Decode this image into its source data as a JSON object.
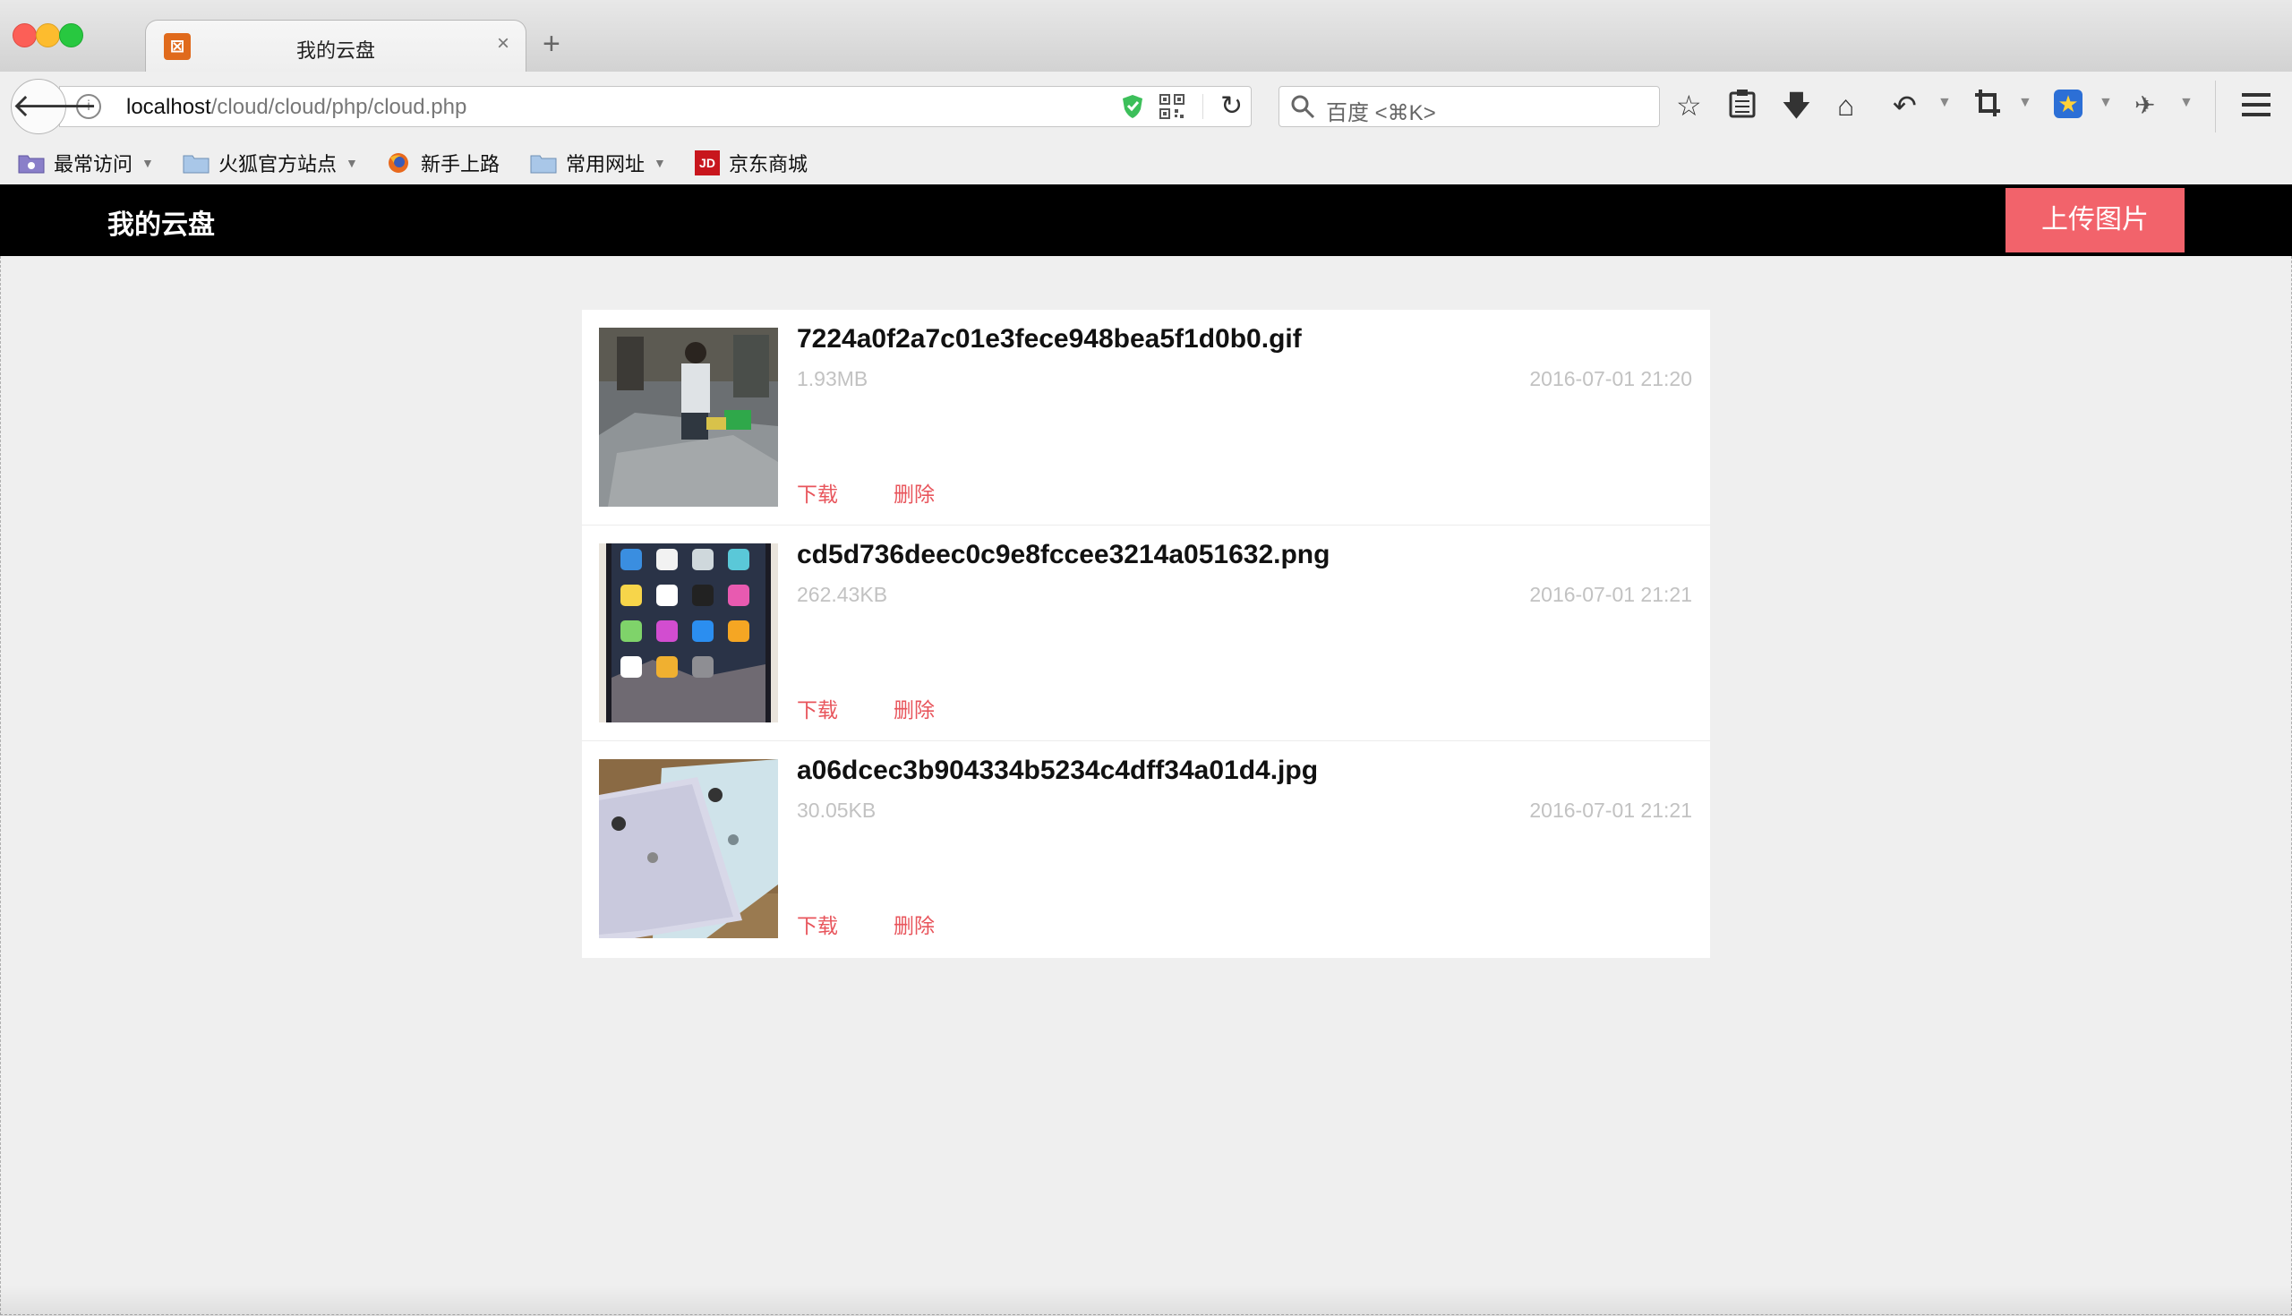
{
  "browser": {
    "tab_title": "我的云盘",
    "new_tab": "+",
    "tab_close": "×",
    "url_host": "localhost",
    "url_path": "/cloud/cloud/php/cloud.php",
    "search_placeholder": "百度 <⌘K>",
    "favicon_label": "⊠",
    "bookmarks": [
      {
        "label": "最常访问",
        "icon": "smart-folder-icon",
        "dropdown": true
      },
      {
        "label": "火狐官方站点",
        "icon": "folder-icon",
        "dropdown": true
      },
      {
        "label": "新手上路",
        "icon": "firefox-icon",
        "dropdown": false
      },
      {
        "label": "常用网址",
        "icon": "folder-icon",
        "dropdown": true
      },
      {
        "label": "京东商城",
        "icon": "jd-icon",
        "dropdown": false
      }
    ],
    "jd_icon_text": "JD"
  },
  "app": {
    "title": "我的云盘",
    "upload_label": "上传图片"
  },
  "files": [
    {
      "name": "7224a0f2a7c01e3fece948bea5f1d0b0.gif",
      "size": "1.93MB",
      "date": "2016-07-01 21:20",
      "download": "下载",
      "delete": "删除"
    },
    {
      "name": "cd5d736deec0c9e8fccee3214a051632.png",
      "size": "262.43KB",
      "date": "2016-07-01 21:21",
      "download": "下载",
      "delete": "删除"
    },
    {
      "name": "a06dcec3b904334b5234c4dff34a01d4.jpg",
      "size": "30.05KB",
      "date": "2016-07-01 21:21",
      "download": "下载",
      "delete": "删除"
    }
  ],
  "colors": {
    "accent": "#f2636b",
    "link": "#e8555c",
    "header_bg": "#000000",
    "page_bg": "#efefef"
  }
}
